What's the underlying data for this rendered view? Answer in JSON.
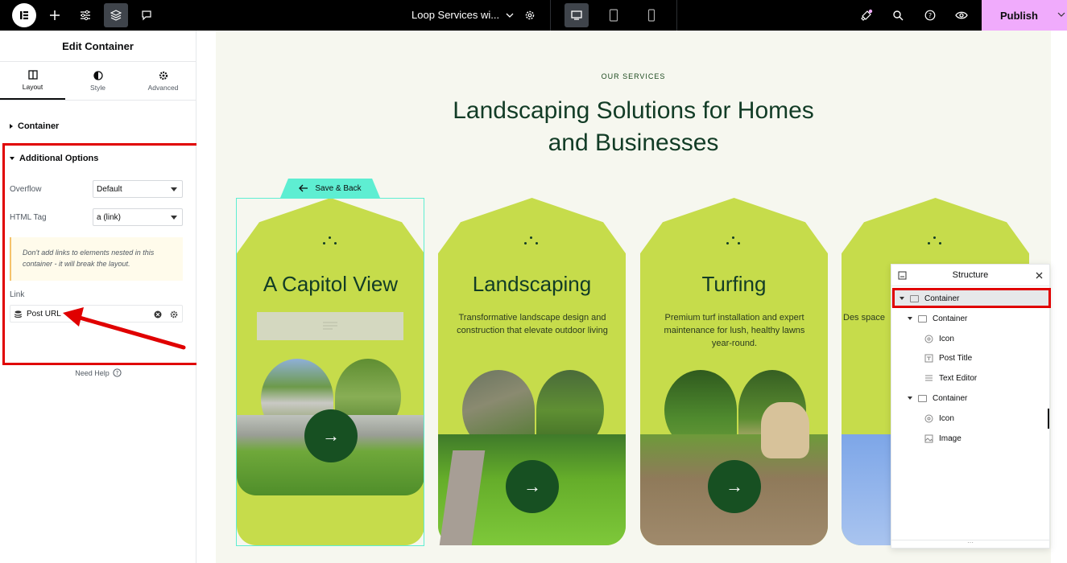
{
  "topbar": {
    "document_title": "Loop Services wi...",
    "publish_label": "Publish"
  },
  "panel": {
    "title": "Edit Container",
    "tabs": [
      {
        "label": "Layout",
        "active": true
      },
      {
        "label": "Style",
        "active": false
      },
      {
        "label": "Advanced",
        "active": false
      }
    ],
    "section_container": "Container",
    "section_additional": "Additional Options",
    "overflow_label": "Overflow",
    "overflow_value": "Default",
    "html_tag_label": "HTML Tag",
    "html_tag_value": "a (link)",
    "notice_text": "Don't add links to elements nested in this container - it will break the layout.",
    "link_label": "Link",
    "link_value": "Post URL",
    "need_help": "Need Help"
  },
  "canvas": {
    "eyebrow": "OUR SERVICES",
    "headline_line1": "Landscaping Solutions for Homes",
    "headline_line2": "and Businesses",
    "save_back_label": "Save & Back",
    "cards": [
      {
        "title": "A Capitol View",
        "description": ""
      },
      {
        "title": "Landscaping",
        "description": "Transformative landscape design and construction that elevate outdoor living"
      },
      {
        "title": "Turfing",
        "description": "Premium turf installation and expert maintenance for lush, healthy lawns year-round."
      },
      {
        "title": "",
        "description": "Des space"
      }
    ],
    "arrow_glyph": "→"
  },
  "structure": {
    "title": "Structure",
    "items": [
      {
        "label": "Container",
        "level": 0,
        "icon": "container-icon",
        "selected": true
      },
      {
        "label": "Container",
        "level": 1,
        "icon": "container-icon"
      },
      {
        "label": "Icon",
        "level": 2,
        "icon": "icon-widget-icon"
      },
      {
        "label": "Post Title",
        "level": 2,
        "icon": "post-title-icon"
      },
      {
        "label": "Text Editor",
        "level": 2,
        "icon": "text-editor-icon"
      },
      {
        "label": "Container",
        "level": 1,
        "icon": "container-icon"
      },
      {
        "label": "Icon",
        "level": 2,
        "icon": "icon-widget-icon"
      },
      {
        "label": "Image",
        "level": 2,
        "icon": "image-icon"
      }
    ]
  },
  "colors": {
    "accent_publish": "#f0abfc",
    "card_green": "#c6dc4b",
    "dark_green": "#175022",
    "highlight_red": "#e00000",
    "selection_cyan": "#5eeed2"
  }
}
